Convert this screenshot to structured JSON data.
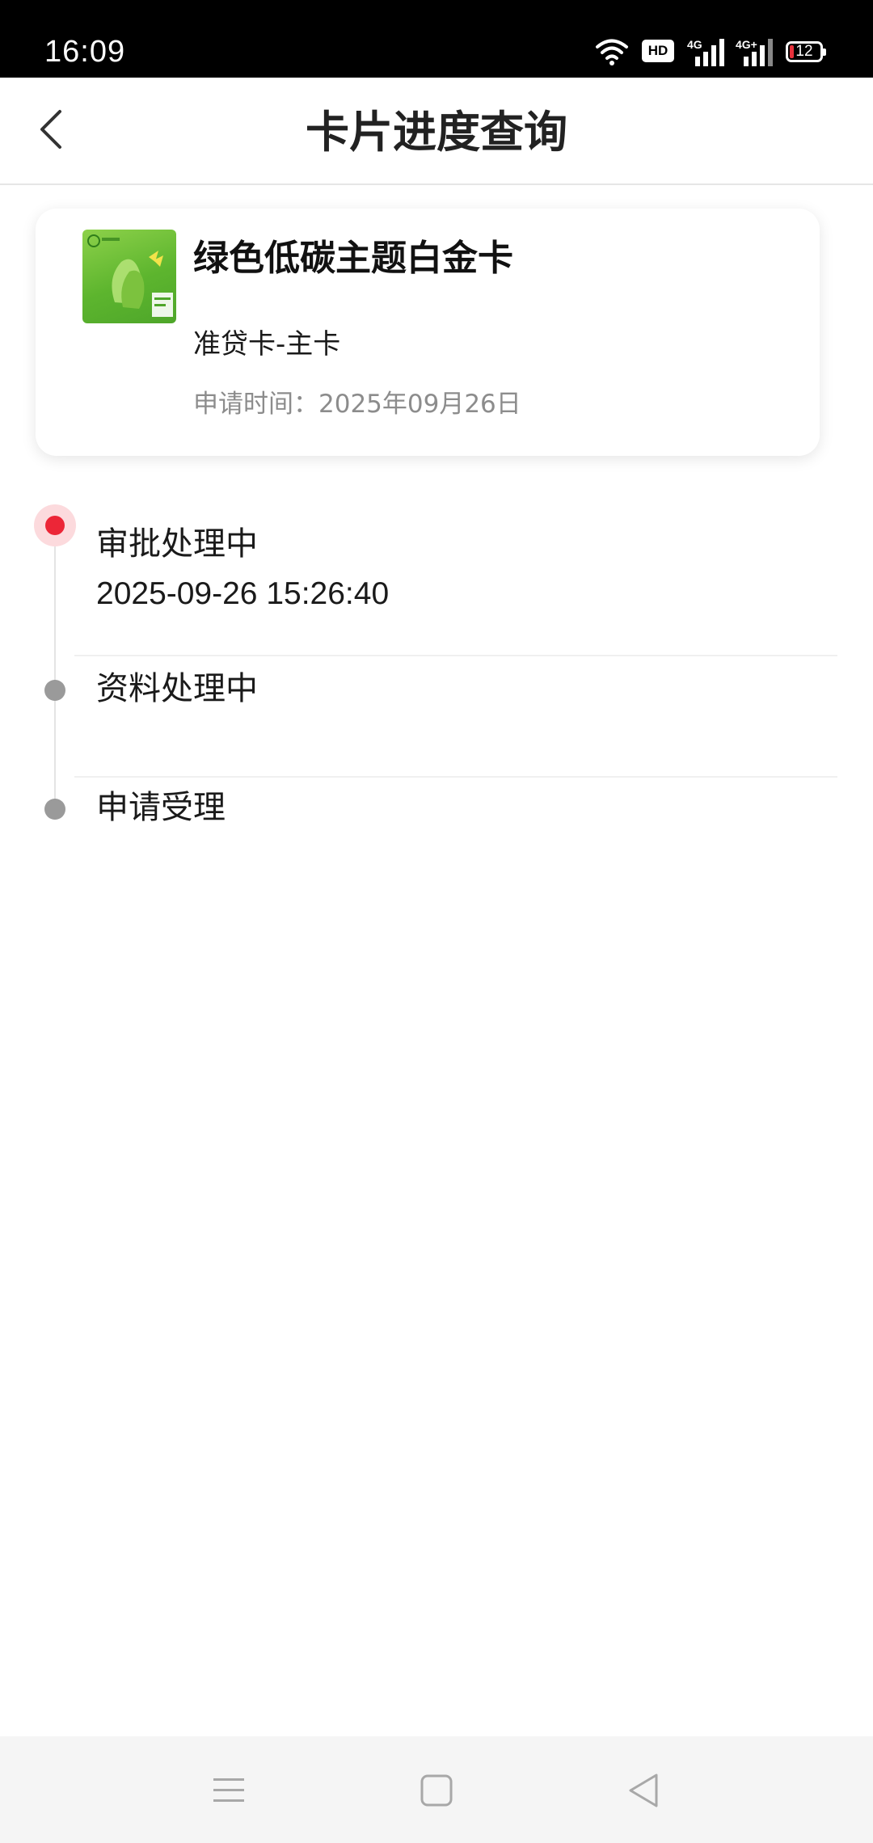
{
  "status_bar": {
    "time": "16:09",
    "hd_label": "HD",
    "battery": "12",
    "icons": [
      "wifi-icon",
      "hd-icon",
      "signal-4g-icon",
      "signal-4g-plus-icon",
      "battery-icon"
    ]
  },
  "header": {
    "title": "卡片进度查询",
    "back_icon": "chevron-left-icon"
  },
  "card": {
    "name": "绿色低碳主题白金卡",
    "type": "准贷卡-主卡",
    "apply_time": "申请时间：2025年09月26日"
  },
  "timeline": {
    "steps": [
      {
        "label": "审批处理中",
        "time": "2025-09-26 15:26:40",
        "status": "active"
      },
      {
        "label": "资料处理中",
        "status": "pending"
      },
      {
        "label": "申请受理",
        "status": "pending"
      }
    ]
  },
  "nav_bar": {
    "icons": [
      "menu-icon",
      "home-icon",
      "back-icon"
    ]
  },
  "colors": {
    "active_dot": "#ec2637",
    "active_halo": "#fcdadd",
    "pending_dot": "#9a9a9a",
    "muted_text": "#8c8c8c"
  }
}
